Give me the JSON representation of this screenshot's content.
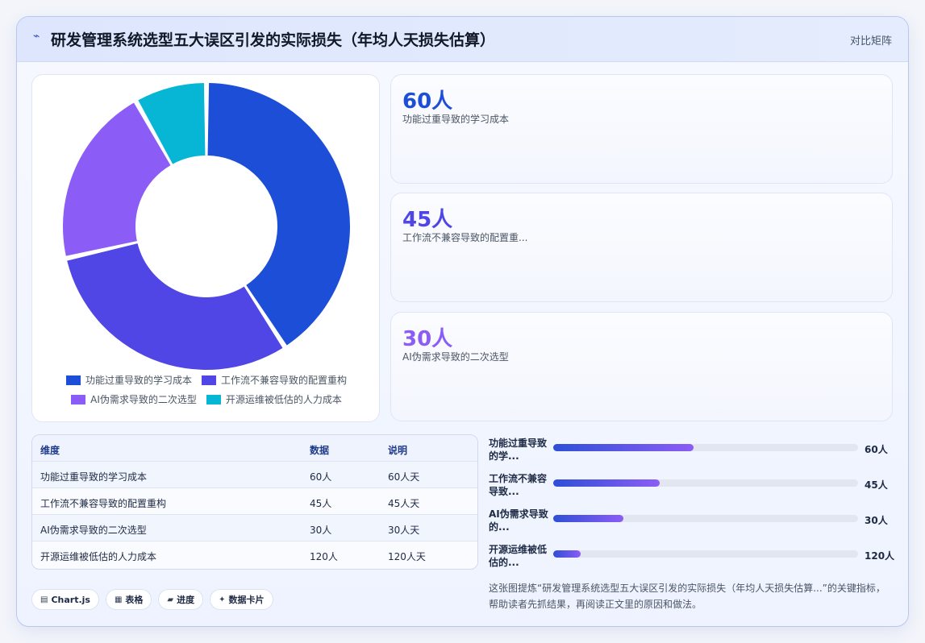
{
  "header": {
    "icon": "pulse-icon",
    "title": "研发管理系统选型五大误区引发的实际损失（年均人天损失估算）",
    "link": "对比矩阵"
  },
  "chart_data": {
    "type": "pie",
    "donut": true,
    "categories": [
      "功能过重导致的学习成本",
      "工作流不兼容导致的配置重构",
      "AI伪需求导致的二次选型",
      "开源运维被低估的人力成本"
    ],
    "values": [
      60,
      45,
      30,
      12
    ],
    "colors": [
      "#1d4ed8",
      "#4f46e5",
      "#8b5cf6",
      "#06b6d4"
    ],
    "legend": "bottom"
  },
  "kpis": [
    {
      "value": "60人",
      "label": "功能过重导致的学习成本",
      "color": "#1d4ed8"
    },
    {
      "value": "45人",
      "label": "工作流不兼容导致的配置重...",
      "color": "#4f46e5"
    },
    {
      "value": "30人",
      "label": "AI伪需求导致的二次选型",
      "color": "#8b5cf6"
    }
  ],
  "table": {
    "headers": [
      "维度",
      "数据",
      "说明"
    ],
    "rows": [
      [
        "功能过重导致的学习成本",
        "60人",
        "60人天"
      ],
      [
        "工作流不兼容导致的配置重构",
        "45人",
        "45人天"
      ],
      [
        "AI伪需求导致的二次选型",
        "30人",
        "30人天"
      ],
      [
        "开源运维被低估的人力成本",
        "120人",
        "120人天"
      ]
    ]
  },
  "bars": [
    {
      "label": "功能过重导致的学...",
      "value": "60人",
      "fill": 0.46
    },
    {
      "label": "工作流不兼容导致...",
      "value": "45人",
      "fill": 0.35
    },
    {
      "label": "AI伪需求导致的...",
      "value": "30人",
      "fill": 0.23
    },
    {
      "label": "开源运维被低估的...",
      "value": "120人",
      "fill": 0.09
    }
  ],
  "description": "这张图提炼“研发管理系统选型五大误区引发的实际损失（年均人天损失估算...”的关键指标，帮助读者先抓结果，再阅读正文里的原因和做法。",
  "chips": [
    {
      "icon": "chart-icon",
      "glyph": "▤",
      "label": "Chart.js"
    },
    {
      "icon": "table-icon",
      "glyph": "▦",
      "label": "表格"
    },
    {
      "icon": "progress-icon",
      "glyph": "▰",
      "label": "进度"
    },
    {
      "icon": "sparkle-icon",
      "glyph": "✦",
      "label": "数据卡片"
    }
  ]
}
